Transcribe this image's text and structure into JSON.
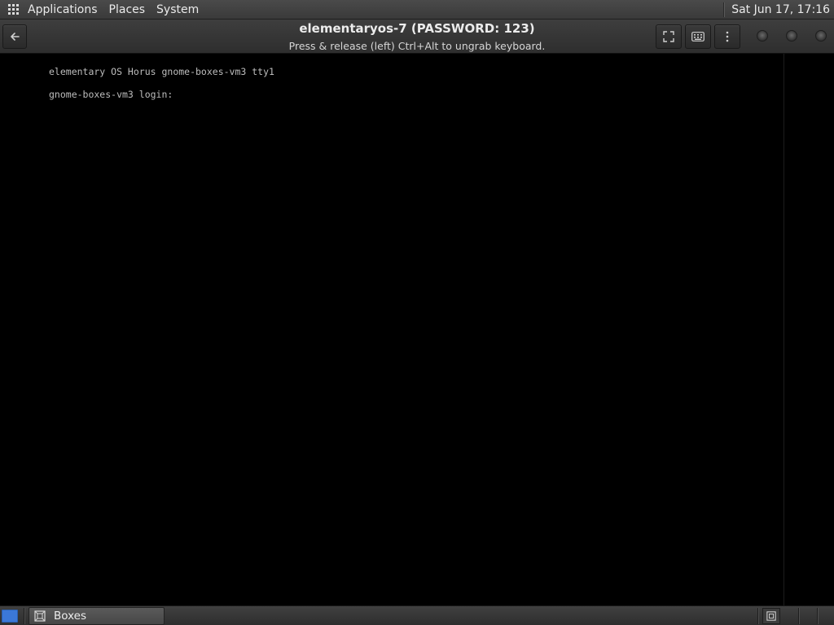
{
  "top_panel": {
    "menus": [
      "Applications",
      "Places",
      "System"
    ],
    "clock": "Sat Jun 17, 17:16",
    "apps_icon": "apps-grid-icon"
  },
  "header": {
    "title": "elementaryos-7 (PASSWORD: 123)",
    "subtitle": "Press & release (left) Ctrl+Alt to ungrab keyboard.",
    "icons": {
      "back": "back-arrow-icon",
      "fullscreen": "fullscreen-icon",
      "keyboard": "keyboard-icon",
      "menu": "more-vertical-icon"
    }
  },
  "console": {
    "lines": [
      "elementary OS Horus gnome-boxes-vm3 tty1",
      "gnome-boxes-vm3 login:"
    ]
  },
  "taskbar": {
    "items": [
      {
        "label": "Boxes",
        "icon": "boxes-app-icon"
      }
    ]
  },
  "colors": {
    "panel": "#3a3a3a",
    "console_bg": "#000000",
    "console_text": "#bdbdbd",
    "show_desktop": "#3b78d8"
  }
}
